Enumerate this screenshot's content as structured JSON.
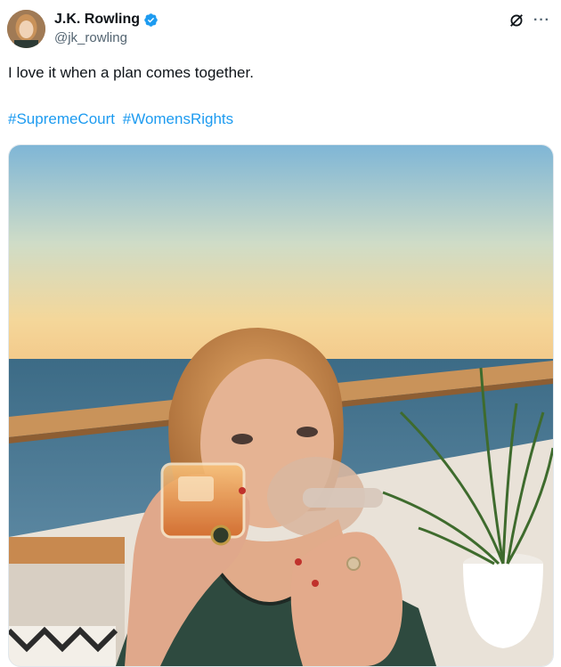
{
  "author": {
    "display_name": "J.K. Rowling",
    "handle": "@jk_rowling",
    "verified": true,
    "avatar_icon": "avatar"
  },
  "actions": {
    "grok_icon": "grok-icon",
    "more_icon": "more-icon",
    "more_label": "···"
  },
  "tweet": {
    "text": "I love it when a plan comes together.",
    "hashtags": [
      "#SupremeCourt",
      "#WomensRights"
    ]
  },
  "colors": {
    "link": "#1d9bf0",
    "text": "#0f1419",
    "secondary": "#536471",
    "verified": "#1d9bf0"
  },
  "media": {
    "type": "photo"
  }
}
